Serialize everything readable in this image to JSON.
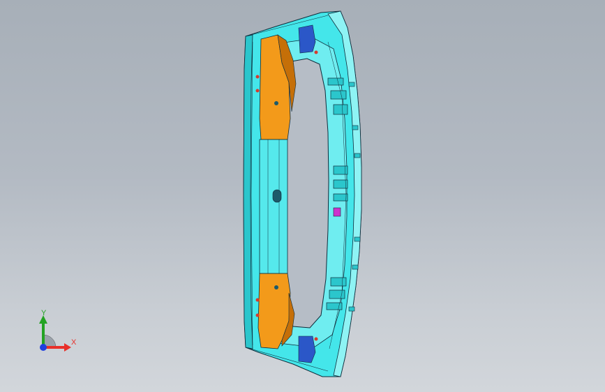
{
  "viewport": {
    "background_top": "#a7afb8",
    "background_bottom": "#d2d6db"
  },
  "model": {
    "colors": {
      "cyan_body": "#44e6ea",
      "cyan_light": "#8ef3f4",
      "cyan_shade": "#2bc6cc",
      "orange_beam": "#f39a1a",
      "orange_dark": "#c56f08",
      "blue_bracket": "#2b57c8",
      "magenta_part": "#cc33cc",
      "red_fastener": "#d63b2e",
      "edge_line": "#0f2b3a"
    }
  },
  "triad": {
    "x_label": "X",
    "y_label": "Y",
    "x_color": "#e8302a",
    "y_color": "#23a323",
    "origin_color": "#1f3fe0"
  }
}
